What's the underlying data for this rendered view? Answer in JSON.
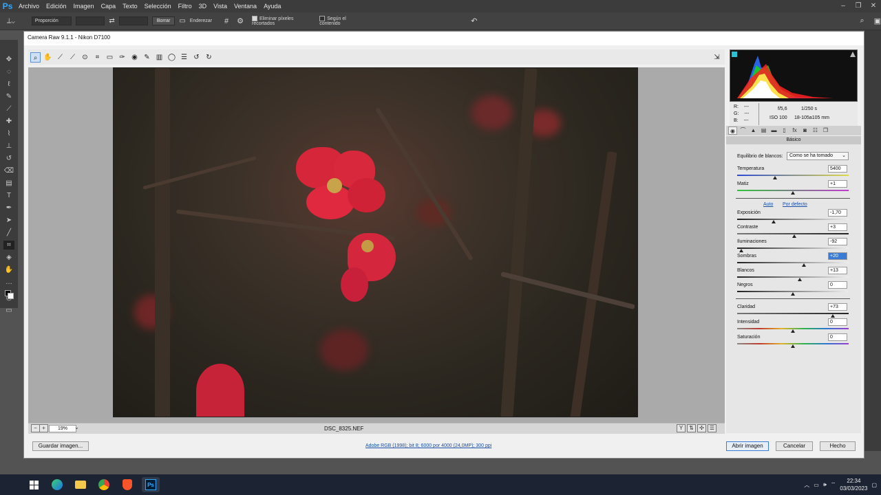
{
  "app": {
    "logo": "Ps",
    "menu": [
      "Archivo",
      "Edición",
      "Imagen",
      "Capa",
      "Texto",
      "Selección",
      "Filtro",
      "3D",
      "Vista",
      "Ventana",
      "Ayuda"
    ],
    "window_controls": [
      "–",
      "❐",
      "✕"
    ]
  },
  "options": {
    "ratio_select": "Proporción",
    "clear_label": "Borrar",
    "straighten_label": "Enderezar",
    "delete_cropped_label": "Eliminar píxeles recortados",
    "delete_cropped_checked": true,
    "content_aware_label": "Según el contenido",
    "content_aware_checked": false
  },
  "left_tools": [
    "crosshair-arrows",
    "lasso",
    "quick-select",
    "eyedropper",
    "crop",
    "brush",
    "stamp",
    "eraser",
    "gradient",
    "type",
    "path-select",
    "rectangle",
    "hand",
    "zoom",
    "more"
  ],
  "dialog": {
    "title": "Camera Raw 9.1.1 -  Nikon D7100",
    "filename": "DSC_8325.NEF",
    "zoom": "19%",
    "save_label": "Guardar imagen...",
    "workflow_link": "Adobe RGB (1998); bit 8; 6000 por 4000 (24,0MP); 300 ppi",
    "open_label": "Abrir imagen",
    "cancel_label": "Cancelar",
    "done_label": "Hecho"
  },
  "info": {
    "r": "R:",
    "g": "G:",
    "b": "B:",
    "dash": "---",
    "aperture": "f/5,6",
    "shutter": "1/250 s",
    "iso": "ISO 100",
    "lens": "18-105a105 mm"
  },
  "panel": {
    "section_title": "Básico",
    "wb_label": "Equilibrio de blancos:",
    "wb_value": "Como se ha tomado",
    "auto_label": "Auto",
    "default_label": "Por defecto",
    "sliders": [
      {
        "label": "Temperatura",
        "value": "5400",
        "pos": 0.34
      },
      {
        "label": "Matiz",
        "value": "+1",
        "pos": 0.5
      },
      {
        "label": "Exposición",
        "value": "-1,70",
        "pos": 0.33
      },
      {
        "label": "Contraste",
        "value": "+3",
        "pos": 0.51
      },
      {
        "label": "Iluminaciones",
        "value": "-92",
        "pos": 0.04
      },
      {
        "label": "Sombras",
        "value": "+20",
        "pos": 0.6
      },
      {
        "label": "Blancos",
        "value": "+13",
        "pos": 0.56
      },
      {
        "label": "Negros",
        "value": "0",
        "pos": 0.5
      },
      {
        "label": "Claridad",
        "value": "+73",
        "pos": 0.86
      },
      {
        "label": "Intensidad",
        "value": "0",
        "pos": 0.5
      },
      {
        "label": "Saturación",
        "value": "0",
        "pos": 0.5
      }
    ]
  },
  "taskbar": {
    "time": "22:34",
    "date": "03/03/2023"
  }
}
